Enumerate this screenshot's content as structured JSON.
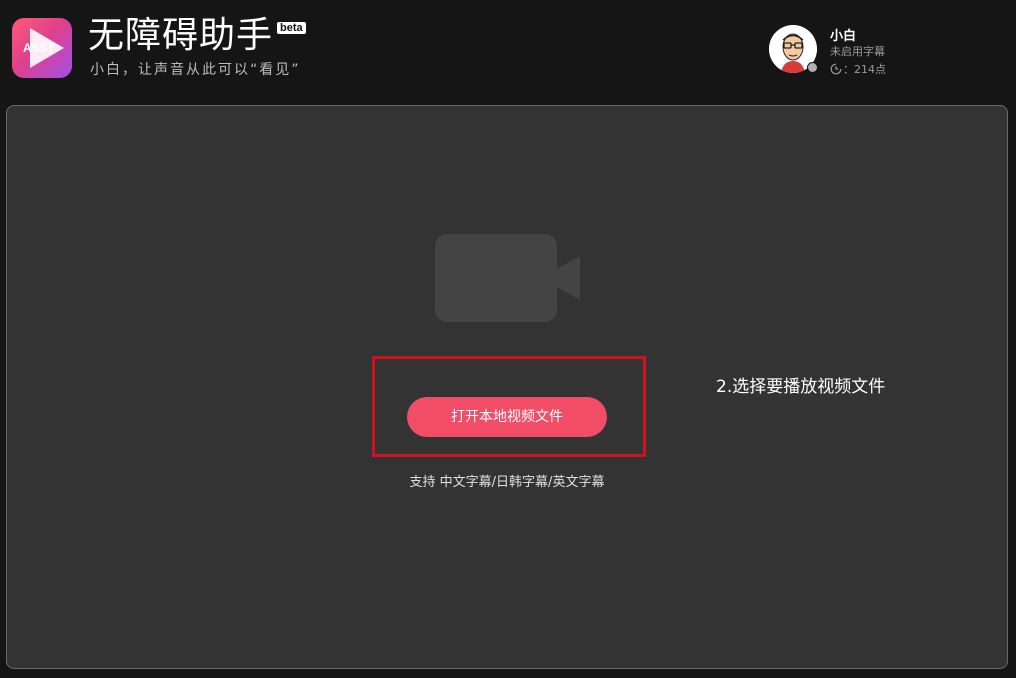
{
  "app": {
    "logo_text": "ASST",
    "title": "无障碍助手",
    "badge": "beta",
    "tagline": "小白，让声音从此可以“看见”"
  },
  "user": {
    "name": "小白",
    "subtitle_status": "未启用字幕",
    "points": "：214点",
    "online_status_color": "#b0b0b0"
  },
  "main": {
    "open_button_label": "打开本地视频文件",
    "support_text": "支持 中文字幕/日韩字幕/英文字幕",
    "annotation": "2.选择要播放视频文件",
    "camera_icon": "video-camera-icon"
  },
  "colors": {
    "accent": "#f24d67",
    "highlight": "#d0121e",
    "panel": "#333333",
    "background": "#151515"
  }
}
